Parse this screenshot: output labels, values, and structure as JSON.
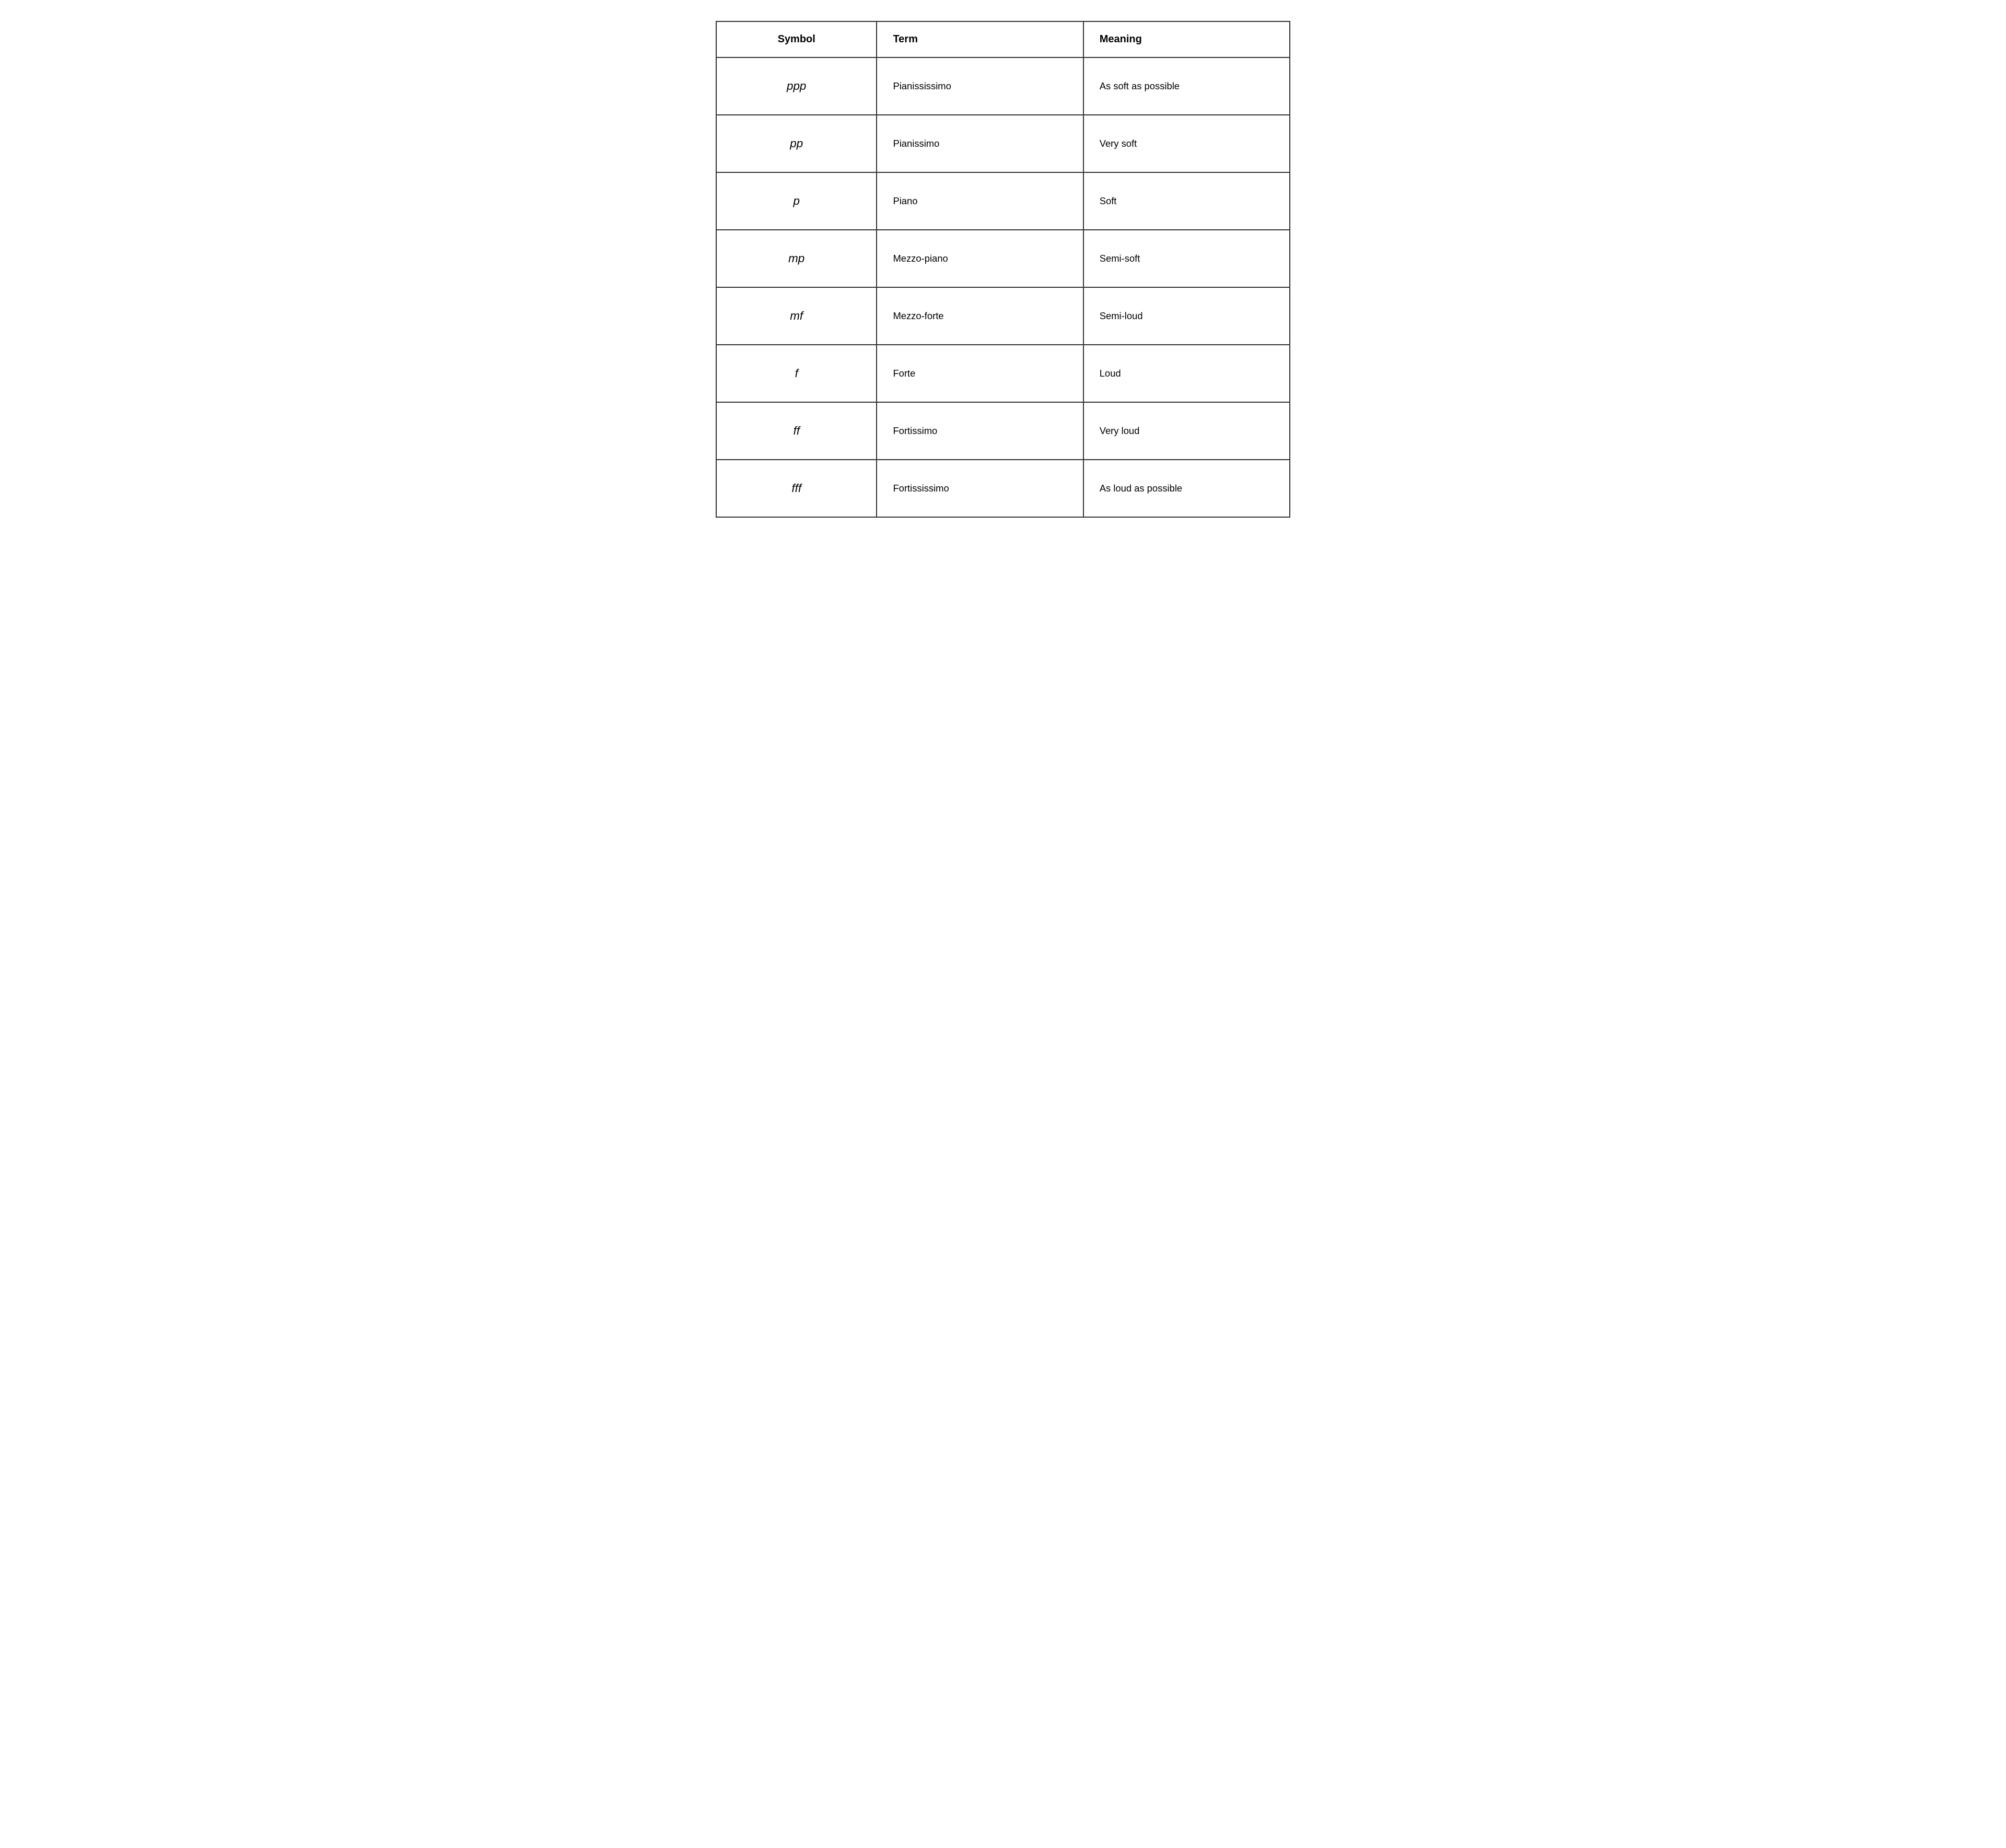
{
  "table": {
    "headers": [
      {
        "id": "symbol",
        "label": "Symbol"
      },
      {
        "id": "term",
        "label": "Term"
      },
      {
        "id": "meaning",
        "label": "Meaning"
      }
    ],
    "rows": [
      {
        "symbol": "ppp",
        "term": "Pianississimo",
        "meaning": "As soft as possible"
      },
      {
        "symbol": "pp",
        "term": "Pianissimo",
        "meaning": "Very soft"
      },
      {
        "symbol": "p",
        "term": "Piano",
        "meaning": "Soft"
      },
      {
        "symbol": "mp",
        "term": "Mezzo-piano",
        "meaning": "Semi-soft"
      },
      {
        "symbol": "mf",
        "term": "Mezzo-forte",
        "meaning": "Semi-loud"
      },
      {
        "symbol": "f",
        "term": "Forte",
        "meaning": "Loud"
      },
      {
        "symbol": "ff",
        "term": "Fortissimo",
        "meaning": "Very loud"
      },
      {
        "symbol": "fff",
        "term": "Fortississimo",
        "meaning": "As loud as possible"
      }
    ]
  }
}
